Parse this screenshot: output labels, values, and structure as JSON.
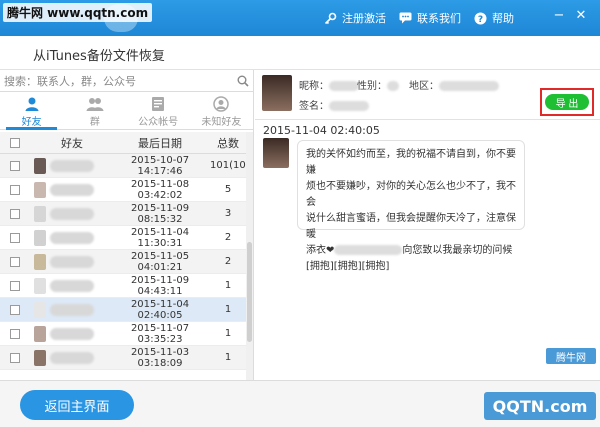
{
  "watermark_top": "腾牛网 www.qqtn.com",
  "topbar": {
    "register_label": "注册激活",
    "contact_label": "联系我们",
    "help_label": "帮助",
    "minimize_glyph": "−",
    "close_glyph": "✕"
  },
  "subheader": {
    "title": "从iTunes备份文件恢复"
  },
  "search": {
    "placeholder": "搜索：联系人，群，公众号"
  },
  "tabs": [
    {
      "label": "好友",
      "icon": "person-icon"
    },
    {
      "label": "群",
      "icon": "group-icon"
    },
    {
      "label": "公众帐号",
      "icon": "public-account-icon"
    },
    {
      "label": "未知好友",
      "icon": "unknown-friend-icon"
    }
  ],
  "table": {
    "headers": [
      "好友",
      "最后日期",
      "总数"
    ],
    "rows": [
      {
        "date": "2015-10-07 14:17:46",
        "total": "101(101)"
      },
      {
        "date": "2015-11-08 03:42:02",
        "total": "5"
      },
      {
        "date": "2015-11-09 08:15:32",
        "total": "3"
      },
      {
        "date": "2015-11-04 11:30:31",
        "total": "2"
      },
      {
        "date": "2015-11-05 04:01:21",
        "total": "2"
      },
      {
        "date": "2015-11-09 04:43:11",
        "total": "1"
      },
      {
        "date": "2015-11-04 02:40:05",
        "total": "1"
      },
      {
        "date": "2015-11-07 03:35:23",
        "total": "1"
      },
      {
        "date": "2015-11-03 03:18:09",
        "total": "1"
      }
    ]
  },
  "contact": {
    "nickname_label": "昵称：",
    "gender_label": "性别：",
    "region_label": "地区：",
    "signature_label": "签名："
  },
  "export_label": "导 出",
  "message": {
    "time": "2015-11-04 02:40:05",
    "line1": "我的关怀如约而至，我的祝福不请自到，你不要嫌",
    "line2": "烦也不要嫌吵，对你的关心怎么也少不了，我不会",
    "line3": "说什么甜言蜜语，但我会提醒你天冷了，注意保暖",
    "line4a": "添衣❤",
    "line4b": "向您致以我最亲切的问候",
    "line5": "[拥抱][拥抱][拥抱]"
  },
  "back_button_label": "返回主界面",
  "watermark_bottom": {
    "badge": "腾牛网",
    "site": "QQTN.com"
  }
}
